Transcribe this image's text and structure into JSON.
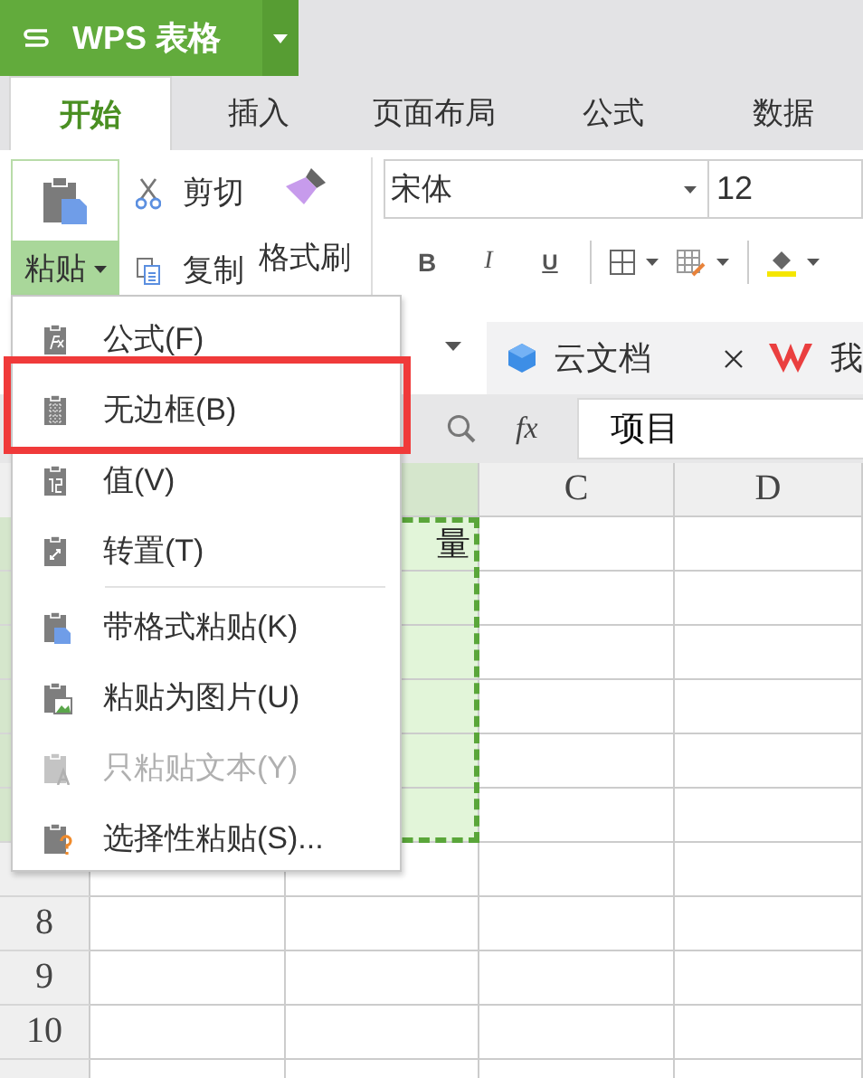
{
  "app": {
    "title": "WPS 表格"
  },
  "tabs": [
    {
      "label": "开始",
      "selected": true
    },
    {
      "label": "插入",
      "selected": false
    },
    {
      "label": "页面布局",
      "selected": false
    },
    {
      "label": "公式",
      "selected": false
    },
    {
      "label": "数据",
      "selected": false
    }
  ],
  "ribbon": {
    "paste": "粘贴",
    "cut": "剪切",
    "copy": "复制",
    "format_painter": "格式刷",
    "font": "宋体",
    "font_size": "12",
    "bold": "B",
    "italic": "I",
    "underline": "U"
  },
  "doc_tabs": [
    {
      "label": "云文档",
      "kind": "cloud"
    },
    {
      "label": "我",
      "kind": "wps"
    }
  ],
  "formula_bar": {
    "fx": "fx",
    "value": "项目"
  },
  "sheet": {
    "columns": [
      {},
      {
        "selected": true
      },
      {
        "label": "C",
        "selected": false
      },
      {
        "label": "D",
        "selected": false
      }
    ],
    "rows": [
      {
        "selected": true,
        "b": "量"
      },
      {
        "selected": true
      },
      {
        "selected": true
      },
      {
        "selected": true
      },
      {
        "selected": true
      },
      {
        "selected": true
      },
      {
        "selected": false
      },
      {
        "label": "8",
        "selected": false
      },
      {
        "label": "9",
        "selected": false
      },
      {
        "label": "10",
        "selected": false
      },
      {
        "selected": false
      }
    ]
  },
  "paste_menu": {
    "items": [
      {
        "label": "公式(F)",
        "kind": "formula",
        "disabled": false,
        "highlighted": false,
        "separator_before": false
      },
      {
        "label": "无边框(B)",
        "kind": "grid",
        "disabled": false,
        "highlighted": true,
        "separator_before": false
      },
      {
        "label": "值(V)",
        "kind": "value",
        "disabled": false,
        "highlighted": false,
        "separator_before": false
      },
      {
        "label": "转置(T)",
        "kind": "transpose",
        "disabled": false,
        "highlighted": false,
        "separator_before": false
      },
      {
        "label": "带格式粘贴(K)",
        "kind": "format",
        "disabled": false,
        "highlighted": false,
        "separator_before": true
      },
      {
        "label": "粘贴为图片(U)",
        "kind": "image",
        "disabled": false,
        "highlighted": false,
        "separator_before": false
      },
      {
        "label": "只粘贴文本(Y)",
        "kind": "text",
        "disabled": true,
        "highlighted": false,
        "separator_before": false
      },
      {
        "label": "选择性粘贴(S)...",
        "kind": "special",
        "disabled": false,
        "highlighted": false,
        "separator_before": false
      }
    ]
  }
}
